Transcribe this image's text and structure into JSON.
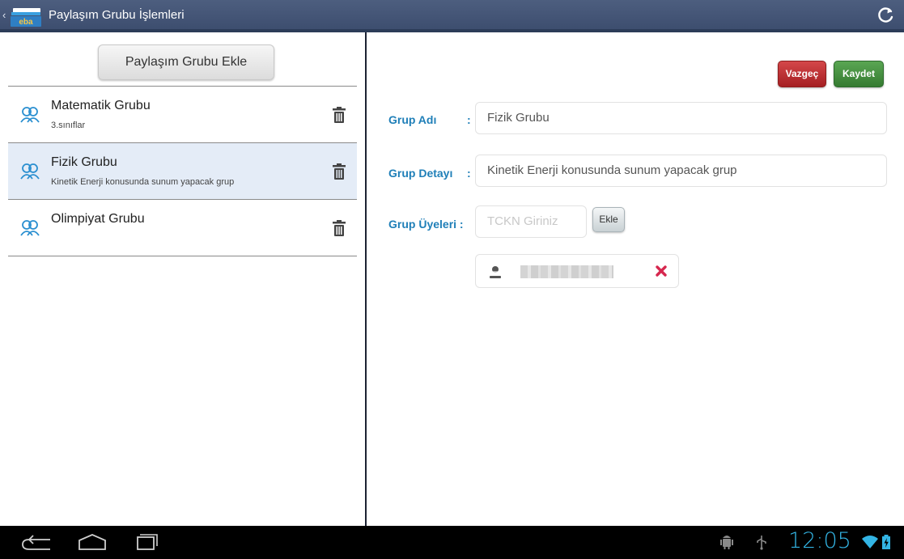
{
  "actionbar": {
    "title": "Paylaşım Grubu İşlemleri",
    "back_glyph": "‹",
    "logo_text": "eba"
  },
  "left": {
    "add_button_label": "Paylaşım Grubu Ekle",
    "groups": [
      {
        "name": "Matematik Grubu",
        "detail": "3.sınıflar",
        "selected": false
      },
      {
        "name": "Fizik Grubu",
        "detail": "Kinetik Enerji konusunda sunum yapacak grup",
        "selected": true
      },
      {
        "name": "Olimpiyat Grubu",
        "detail": "",
        "selected": false
      }
    ]
  },
  "right": {
    "cancel_label": "Vazgeç",
    "save_label": "Kaydet",
    "name_label": "Grup Adı",
    "detail_label": "Grup Detayı",
    "members_label": "Grup Üyeleri :",
    "colon": ":",
    "name_value": "Fizik Grubu",
    "detail_value": "Kinetik Enerji konusunda sunum yapacak grup",
    "tckn_placeholder": "TCKN Giriniz",
    "add_member_label": "Ekle"
  },
  "statusbar": {
    "clock": "12:05"
  },
  "colors": {
    "actionbar": "#4d5e7f",
    "label_blue": "#1f7fb8",
    "cancel_red": "#c0392b",
    "save_green": "#4a9a44",
    "clock_blue": "#33b5e5",
    "selected_row": "#e4ecf7"
  },
  "icons": [
    "back-icon",
    "eba-logo",
    "refresh-icon",
    "group-icon",
    "trash-icon",
    "user-icon",
    "remove-x-icon",
    "nav-back-icon",
    "nav-home-icon",
    "nav-recents-icon",
    "android-debug-icon",
    "usb-icon",
    "wifi-icon",
    "battery-icon"
  ]
}
